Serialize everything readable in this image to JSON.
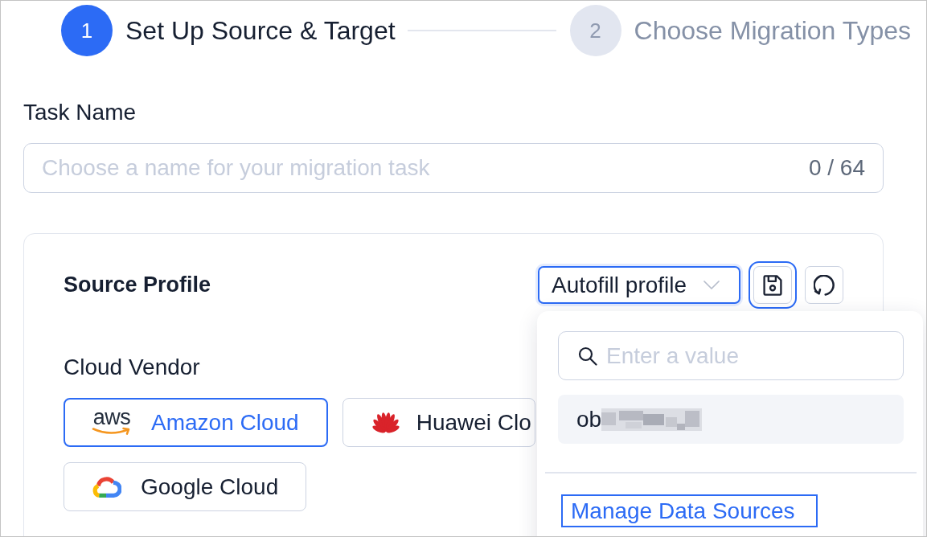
{
  "steps": [
    {
      "number": "1",
      "label": "Set Up Source & Target",
      "active": true
    },
    {
      "number": "2",
      "label": "Choose Migration Types",
      "active": false
    }
  ],
  "task_name": {
    "label": "Task Name",
    "placeholder": "Choose a name for your migration task",
    "counter": "0 / 64"
  },
  "source_profile": {
    "title": "Source Profile",
    "autofill_select": {
      "value": "Autofill profile",
      "open": true,
      "dropdown": {
        "search_placeholder": "Enter a value",
        "options": [
          {
            "label": "ob",
            "redacted": true,
            "highlighted": true
          }
        ],
        "footer_link": {
          "label": "Manage Data Sources",
          "focused": true
        }
      }
    },
    "actions": [
      {
        "kind": "save",
        "focused": true
      },
      {
        "kind": "refresh",
        "focused": false
      }
    ],
    "cloud_vendor": {
      "label": "Cloud Vendor",
      "vendors": [
        {
          "kind": "aws",
          "logo_text": "aws",
          "label": "Amazon Cloud",
          "selected": true
        },
        {
          "kind": "huawei",
          "label": "Huawei Clo",
          "selected": false
        },
        {
          "kind": "google",
          "label": "Google Cloud",
          "selected": false
        }
      ]
    }
  }
}
